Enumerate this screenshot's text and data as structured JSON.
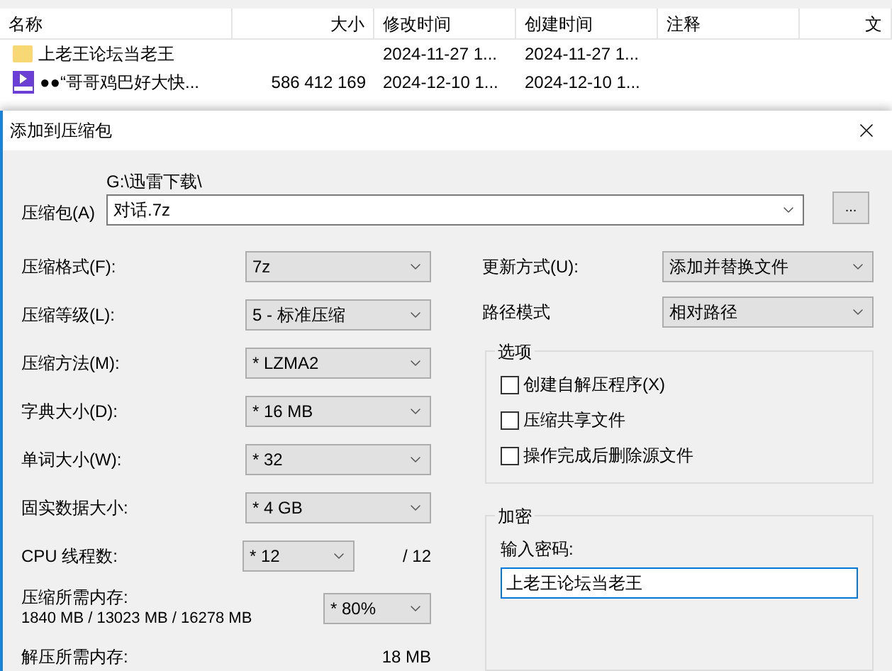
{
  "file_list": {
    "columns": [
      "名称",
      "大小",
      "修改时间",
      "创建时间",
      "注释",
      "文"
    ],
    "rows": [
      {
        "kind": "folder",
        "name": "上老王论坛当老王",
        "modified": "2024-11-27 1...",
        "created": "2024-11-27 1..."
      },
      {
        "kind": "video",
        "name": "●●“哥哥鸡巴好大快...",
        "size": "586 412 169",
        "modified": "2024-12-10 1...",
        "created": "2024-12-10 1..."
      }
    ]
  },
  "dialog": {
    "title": "添加到压缩包",
    "archive": {
      "label": "压缩包(A)",
      "path": "G:\\迅雷下载\\",
      "value": "对话.7z",
      "browse": "..."
    },
    "settings": [
      {
        "label": "压缩格式(F):",
        "value": "7z"
      },
      {
        "label": "压缩等级(L):",
        "value": "5 - 标准压缩"
      },
      {
        "label": "压缩方法(M):",
        "value": "* LZMA2"
      },
      {
        "label": "字典大小(D):",
        "value": "* 16 MB"
      },
      {
        "label": "单词大小(W):",
        "value": "* 32"
      },
      {
        "label": "固实数据大小:",
        "value": "* 4 GB"
      }
    ],
    "cpu": {
      "label": "CPU 线程数:",
      "value": "* 12",
      "max": "/ 12"
    },
    "memory": {
      "label": "压缩所需内存:",
      "detail": "1840 MB / 13023 MB / 16278 MB",
      "value": "* 80%"
    },
    "decompress": {
      "label": "解压所需内存:",
      "value": "18 MB"
    },
    "update_mode": {
      "label": "更新方式(U):",
      "value": "添加并替换文件"
    },
    "path_mode": {
      "label": "路径模式",
      "value": "相对路径"
    },
    "options": {
      "title": "选项",
      "items": [
        {
          "label": "创建自解压程序(X)",
          "checked": false
        },
        {
          "label": "压缩共享文件",
          "checked": false
        },
        {
          "label": "操作完成后删除源文件",
          "checked": false
        }
      ]
    },
    "encryption": {
      "title": "加密",
      "label": "输入密码:",
      "value": "上老王论坛当老王"
    }
  }
}
